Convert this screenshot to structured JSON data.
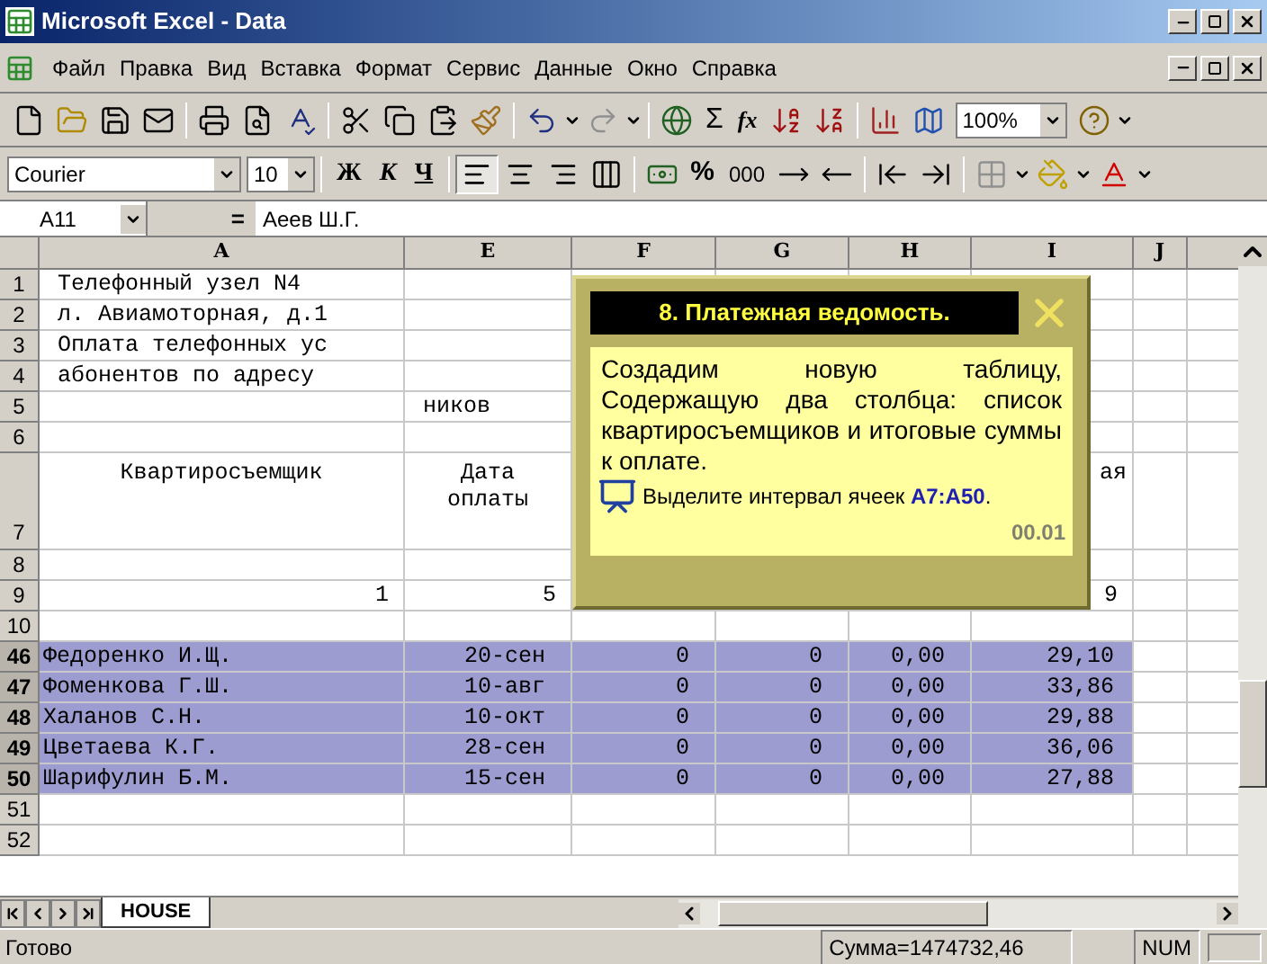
{
  "window": {
    "title": "Microsoft Excel - Data"
  },
  "menu": [
    "Файл",
    "Правка",
    "Вид",
    "Вставка",
    "Формат",
    "Сервис",
    "Данные",
    "Окно",
    "Справка"
  ],
  "standard_toolbar": {
    "sum": "Σ",
    "function": "fx",
    "zoom": "100%"
  },
  "formatting_toolbar": {
    "font": "Courier",
    "size": "10",
    "styles": [
      "Ж",
      "К",
      "Ч"
    ],
    "align": [
      {
        "kind": "left",
        "selected": true
      },
      {
        "kind": "center",
        "selected": false
      },
      {
        "kind": "right",
        "selected": false
      }
    ],
    "percent": "%",
    "thousands": "000"
  },
  "formula_bar": {
    "name_box": "A11",
    "equals": "=",
    "value": "Аеев Ш.Г."
  },
  "columns": [
    "A",
    "E",
    "F",
    "G",
    "H",
    "I",
    "J"
  ],
  "rows": [
    {
      "number": "1",
      "kind": "title",
      "selected": false,
      "cells": {
        "A": "Телефонный узел N4"
      }
    },
    {
      "number": "2",
      "kind": "title",
      "selected": false,
      "cells": {
        "A": "л. Авиамоторная, д.1"
      }
    },
    {
      "number": "3",
      "kind": "title",
      "selected": false,
      "cells": {
        "A": "Оплата телефонных ус"
      }
    },
    {
      "number": "4",
      "kind": "title",
      "selected": false,
      "cells": {
        "A": "абонентов по адресу"
      }
    },
    {
      "number": "5",
      "kind": "title",
      "selected": false,
      "cells": {
        "E": "ников"
      }
    },
    {
      "number": "6",
      "kind": "blank",
      "selected": false,
      "cells": {}
    },
    {
      "number": "7",
      "kind": "header",
      "selected": false,
      "cells": {
        "A": "Квартиросъемщик",
        "E": "Дата оплаты",
        "I": "ая"
      }
    },
    {
      "number": "8",
      "kind": "blank",
      "selected": false,
      "cells": {}
    },
    {
      "number": "9",
      "kind": "numbers",
      "selected": false,
      "cells": {
        "A": "1",
        "E": "5",
        "I": "9"
      }
    },
    {
      "number": "10",
      "kind": "blank",
      "selected": false,
      "cells": {}
    },
    {
      "number": "46",
      "kind": "record",
      "selected": true,
      "cells": {
        "A": "Федоренко И.Щ.",
        "E": "20-сен",
        "F": "0",
        "G": "0",
        "H": "0,00",
        "I": "29,10"
      }
    },
    {
      "number": "47",
      "kind": "record",
      "selected": true,
      "cells": {
        "A": "Фоменкова Г.Ш.",
        "E": "10-авг",
        "F": "0",
        "G": "0",
        "H": "0,00",
        "I": "33,86"
      }
    },
    {
      "number": "48",
      "kind": "record",
      "selected": true,
      "cells": {
        "A": "Халанов С.Н.",
        "E": "10-окт",
        "F": "0",
        "G": "0",
        "H": "0,00",
        "I": "29,88"
      }
    },
    {
      "number": "49",
      "kind": "record",
      "selected": true,
      "cells": {
        "A": "Цветаева К.Г.",
        "E": "28-сен",
        "F": "0",
        "G": "0",
        "H": "0,00",
        "I": "36,06"
      }
    },
    {
      "number": "50",
      "kind": "record",
      "selected": true,
      "cells": {
        "A": "Шарифулин Б.М.",
        "E": "15-сен",
        "F": "0",
        "G": "0",
        "H": "0,00",
        "I": "27,88"
      }
    },
    {
      "number": "51",
      "kind": "blank",
      "selected": false,
      "cells": {}
    },
    {
      "number": "52",
      "kind": "blank",
      "selected": false,
      "cells": {}
    }
  ],
  "tutorial": {
    "title": "8. Платежная ведомость.",
    "text": "Создадим новую таблицу, Содержащую два столбца: список квартиросъемщиков и итоговые суммы к оплате.",
    "instruction": "Выделите интервал ячеек **A7:A50**.",
    "counter": "00.01"
  },
  "sheet_tabs": [
    {
      "label": "HOUSE",
      "selected": true
    }
  ],
  "status_bar": {
    "status": "Готово",
    "sum": "Сумма=1474732,46",
    "num": "NUM"
  }
}
